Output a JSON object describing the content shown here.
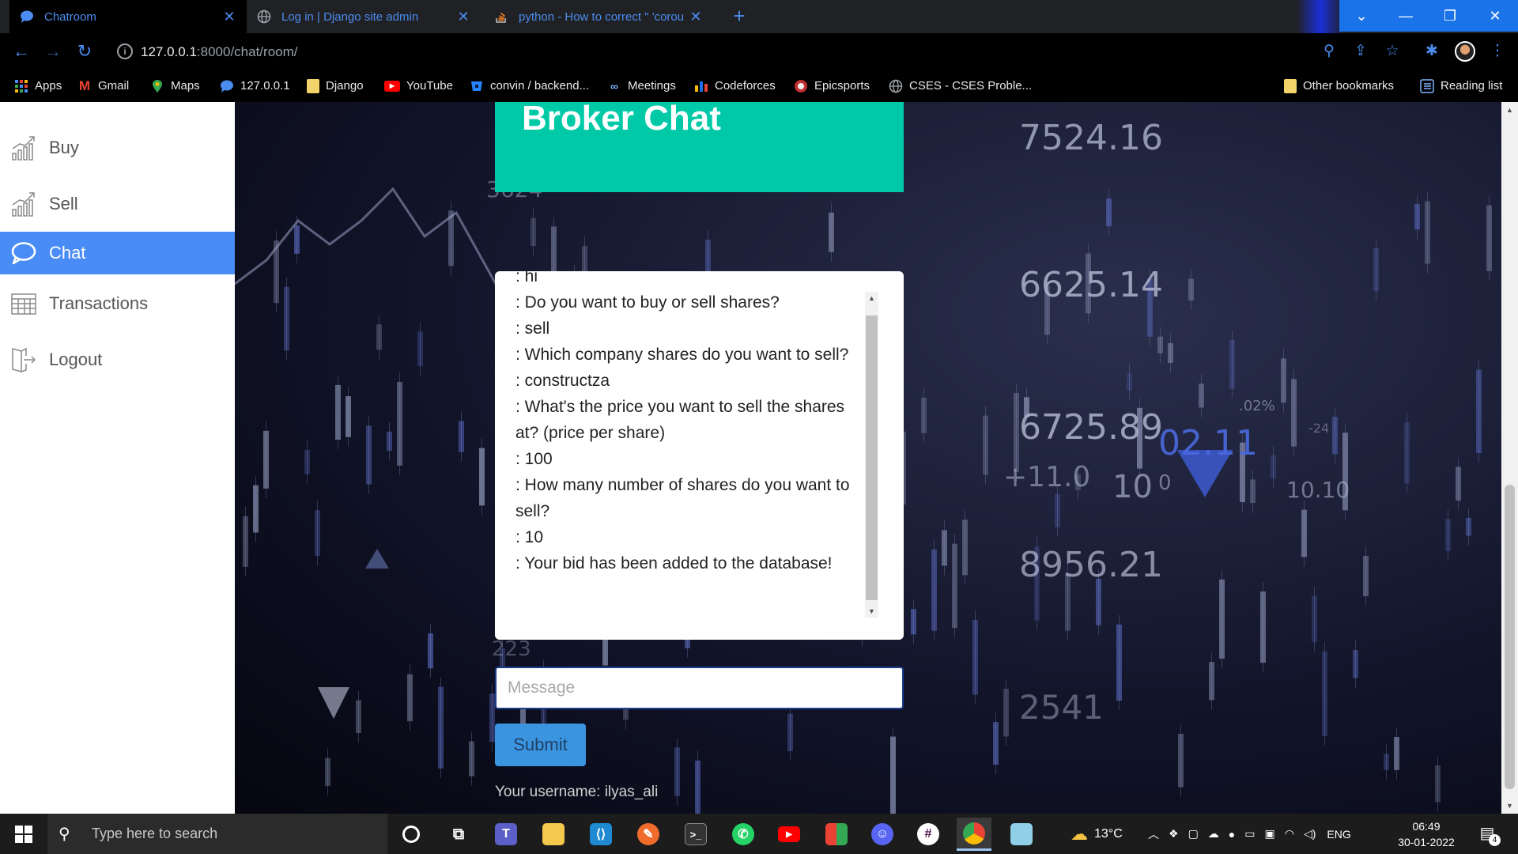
{
  "browser": {
    "tabs": [
      {
        "title": "Chatroom",
        "active": true
      },
      {
        "title": "Log in | Django site admin",
        "active": false
      },
      {
        "title": "python - How to correct \" 'corou",
        "active": false
      }
    ],
    "new_tab_label": "+",
    "url_host": "127.0.0.1",
    "url_path": ":8000/chat/room/",
    "bookmarks": [
      {
        "label": "Apps",
        "icon": "apps-grid-icon"
      },
      {
        "label": "Gmail",
        "icon": "gmail-icon"
      },
      {
        "label": "Maps",
        "icon": "maps-icon"
      },
      {
        "label": "127.0.0.1",
        "icon": "chat-bubble-icon"
      },
      {
        "label": "Django",
        "icon": "folder-icon"
      },
      {
        "label": "YouTube",
        "icon": "youtube-icon"
      },
      {
        "label": "convin / backend...",
        "icon": "bitbucket-icon"
      },
      {
        "label": "Meetings",
        "icon": "meetings-icon"
      },
      {
        "label": "Codeforces",
        "icon": "codeforces-icon"
      },
      {
        "label": "Epicsports",
        "icon": "epicsports-icon"
      },
      {
        "label": "CSES - CSES Proble...",
        "icon": "globe-icon"
      }
    ],
    "other_bookmarks": "Other bookmarks",
    "reading_list": "Reading list"
  },
  "sidebar": {
    "items": [
      {
        "label": "Buy",
        "icon": "chart-icon",
        "active": false
      },
      {
        "label": "Sell",
        "icon": "chart-icon",
        "active": false
      },
      {
        "label": "Chat",
        "icon": "chat-bubble-icon",
        "active": true
      },
      {
        "label": "Transactions",
        "icon": "table-icon",
        "active": false
      },
      {
        "label": "Logout",
        "icon": "logout-icon",
        "active": false
      }
    ]
  },
  "main": {
    "title": "Broker Chat",
    "chat_messages": [
      ": hi",
      ": Do you want to buy or sell shares?",
      ": sell",
      ": Which company shares do you want to sell?",
      ": constructza",
      ": What's the price you want to sell the shares at? (price per share)",
      ": 100",
      ": How many number of shares do you want to sell?",
      ": 10",
      ": Your bid has been added to the database!"
    ],
    "message_placeholder": "Message",
    "message_value": "",
    "submit_label": "Submit",
    "username_text": "Your username: ilyas_ali"
  },
  "background_labels": [
    "7524.16",
    "3624",
    "6625.14",
    "6725.89",
    "02.11",
    "+11.0",
    "10",
    "0",
    "10.10",
    ".02%",
    "-24",
    "8956.21",
    "2541",
    "223"
  ],
  "taskbar": {
    "search_placeholder": "Type here to search",
    "weather": "13°C",
    "language": "ENG",
    "time": "06:49",
    "date": "30-01-2022",
    "notifications_count": "4"
  },
  "colors": {
    "accent_blue": "#4a8cf5",
    "header_teal": "#00c9a7",
    "submit_blue": "#3b94e0"
  }
}
